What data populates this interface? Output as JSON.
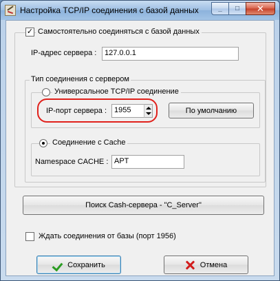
{
  "window": {
    "title": "Настройка TCP/IP соединения с базой данных",
    "controls": {
      "minimize": "_",
      "maximize": "□",
      "close": "✕"
    }
  },
  "connect_self": {
    "label": "Самостоятельно соединяться с базой данных",
    "checked": true,
    "mark": "✓"
  },
  "server_ip": {
    "label": "IP-адрес сервера :",
    "value": "127.0.0.1"
  },
  "connection_type": {
    "title": "Тип соединения с сервером",
    "tcp": {
      "label": "Универсальное TCP/IP соединение",
      "selected": false,
      "port_label": "IP-порт сервера :",
      "port_value": "1955",
      "default_button": "По умолчанию"
    },
    "cache": {
      "label": "Соединение с Cache",
      "selected": true,
      "namespace_label": "Namespace CACHE :",
      "namespace_value": "APT"
    },
    "search_button": "Поиск Cash-сервера - \"C_Server\""
  },
  "wait_db": {
    "label": "Ждать соединения от базы (порт 1956)",
    "checked": false
  },
  "buttons": {
    "save": "Сохранить",
    "cancel": "Отмена"
  },
  "colors": {
    "highlight_ring": "#e0201b",
    "save_icon": "#2a9c22",
    "cancel_icon": "#d21d1d"
  }
}
